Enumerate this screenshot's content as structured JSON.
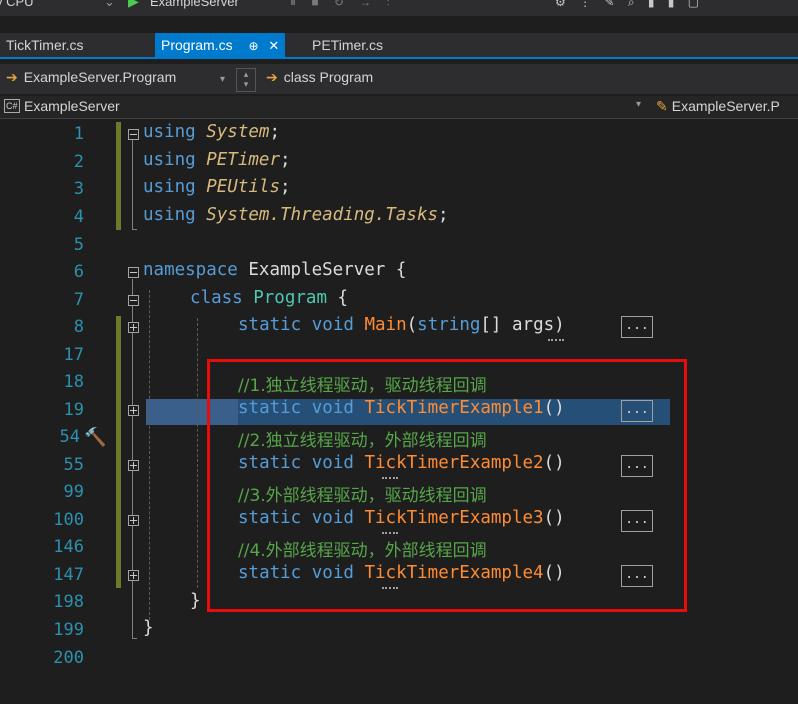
{
  "toolbar": {
    "config_label": "y CPU",
    "run_target": "ExampleServer"
  },
  "tabs": [
    {
      "label": "TickTimer.cs"
    },
    {
      "label": "Program.cs",
      "pin": "⊕",
      "close": "✕"
    },
    {
      "label": "PETimer.cs"
    }
  ],
  "navbar": {
    "type_label": "ExampleServer.Program",
    "member_label": "class Program"
  },
  "projectbar": {
    "project": "ExampleServer",
    "right": "ExampleServer.P"
  },
  "editor": {
    "line_numbers": [
      "1",
      "2",
      "3",
      "4",
      "5",
      "6",
      "7",
      "8",
      "17",
      "18",
      "19",
      "54",
      "55",
      "99",
      "100",
      "146",
      "147",
      "198",
      "199",
      "200"
    ],
    "lines": {
      "l1": {
        "kw": "using",
        "ns": "System",
        "end": ";"
      },
      "l2": {
        "kw": "using",
        "ns": "PETimer",
        "end": ";"
      },
      "l3": {
        "kw": "using",
        "ns": "PEUtils",
        "end": ";"
      },
      "l4": {
        "kw": "using",
        "ns": "System.Threading.Tasks",
        "end": ";"
      },
      "l6": {
        "kw": "namespace",
        "name": "ExampleServer",
        "brace": "{"
      },
      "l7": {
        "kw": "class",
        "name": "Program",
        "brace": "{"
      },
      "l8": {
        "kw1": "static",
        "kw2": "void",
        "fn": "Main",
        "open": "(",
        "type": "string",
        "rest": "[] ",
        "arg": "args",
        "close": ")"
      },
      "c18": "//1.独立线程驱动，驱动线程回调",
      "l19": {
        "kw1": "static",
        "kw2": "void",
        "fn": "TickTimerExample1",
        "parens": "()"
      },
      "c54": "//2.独立线程驱动，外部线程回调",
      "l55": {
        "kw1": "static",
        "kw2": "void",
        "fn": "TickTimerExample2",
        "parens": "()"
      },
      "c99": "//3.外部线程驱动，驱动线程回调",
      "l100": {
        "kw1": "static",
        "kw2": "void",
        "fn": "TickTimerExample3",
        "parens": "()"
      },
      "c146": "//4.外部线程驱动，外部线程回调",
      "l147": {
        "kw1": "static",
        "kw2": "void",
        "fn": "TickTimerExample4",
        "parens": "()"
      },
      "l198": "}",
      "l199": "}"
    },
    "collapsed_label": "..."
  },
  "colors": {
    "keyword": "#569cd6",
    "namespace": "#d7ba7d",
    "type": "#4ec9b0",
    "method": "#ff8c32",
    "comment": "#57a64a",
    "line_number": "#2b91af",
    "highlight_box": "#e80d0d",
    "selection": "#264f78"
  },
  "icons": [
    "play-icon",
    "fold-minus-icon",
    "fold-plus-icon",
    "hammer-icon",
    "arrow-right-icon"
  ]
}
